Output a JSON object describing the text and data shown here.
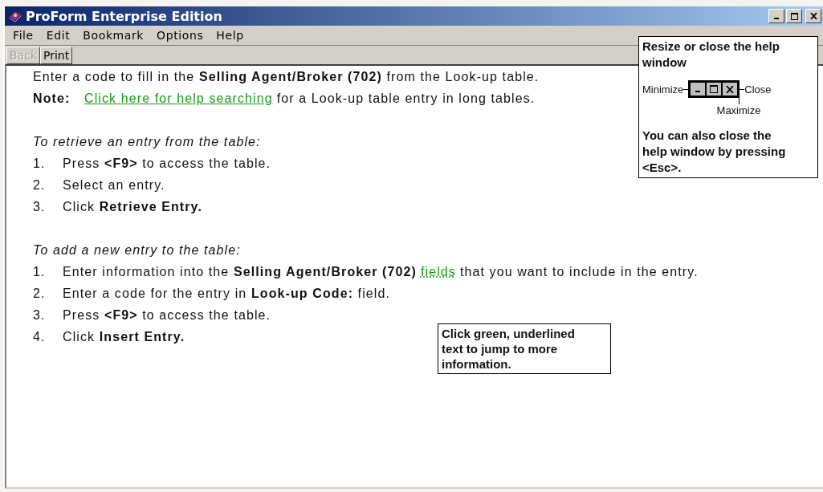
{
  "window": {
    "title": "ProForm Enterprise Edition"
  },
  "menu": [
    {
      "label": "File"
    },
    {
      "label": "Edit"
    },
    {
      "label": "Bookmark"
    },
    {
      "label": "Options"
    },
    {
      "label": "Help"
    }
  ],
  "toolbar": [
    {
      "label": "Back",
      "disabled": true
    },
    {
      "label": "Print",
      "disabled": false
    }
  ],
  "intro": "Enter a code to fill in the **Selling Agent/Broker (702)** from the Look-up table.",
  "note": {
    "label": "Note:",
    "link": "Click here for help searching",
    "text": "for a Look-up table entry in long tables."
  },
  "sections": [
    {
      "heading": "To retrieve an entry from the table:",
      "steps": [
        {
          "number": "1.",
          "parts": [
            {
              "kind": "text",
              "text": "Press **<F9>** to access the table."
            }
          ]
        },
        {
          "number": "2.",
          "parts": [
            {
              "kind": "text",
              "text": "Select an entry."
            }
          ]
        },
        {
          "number": "3.",
          "parts": [
            {
              "kind": "text",
              "text": "Click **Retrieve Entry.**"
            }
          ]
        }
      ]
    },
    {
      "heading": "To add a new entry to the table:",
      "steps": [
        {
          "number": "1.",
          "parts": [
            {
              "kind": "text",
              "text": "Enter information into the **Selling Agent/Broker (702)**"
            },
            {
              "kind": "link",
              "text": "fields"
            },
            {
              "kind": "text",
              "text": "that you want to include in the entry."
            }
          ]
        },
        {
          "number": "2.",
          "parts": [
            {
              "kind": "text",
              "text": "Enter a code for the entry in **Look-up Code:** field."
            }
          ]
        },
        {
          "number": "3.",
          "parts": [
            {
              "kind": "text",
              "text": "Press **<F9>** to access the table."
            }
          ]
        },
        {
          "number": "4.",
          "parts": [
            {
              "kind": "text",
              "text": "Click **Insert Entry.**"
            }
          ]
        }
      ]
    }
  ],
  "callouts": [
    {
      "kind": "controls",
      "title": "Resize or close the help window",
      "minimize": "Minimize",
      "maximize": "Maximize",
      "close": "Close",
      "text": "You can also close the help window by pressing <Esc>."
    },
    {
      "kind": "links",
      "text": "Click green, underlined text to jump to more information."
    }
  ]
}
